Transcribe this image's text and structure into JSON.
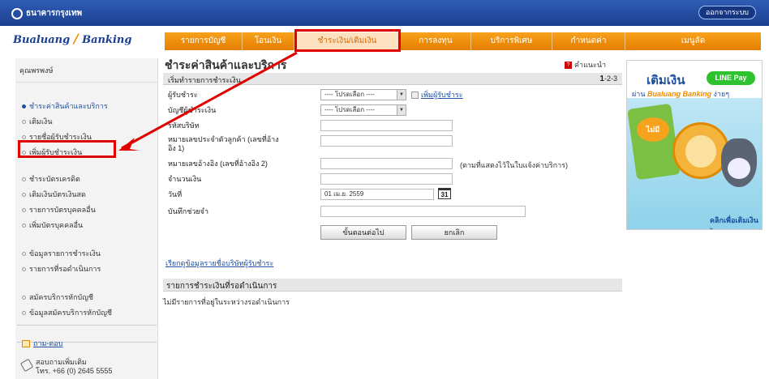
{
  "topbar": {
    "bank_name": "ธนาคารกรุงเทพ",
    "logout_label": "ออกจากระบบ"
  },
  "brand": {
    "left": "Bualuang",
    "right": "Banking"
  },
  "nav": {
    "items": [
      {
        "label": "รายการบัญชี",
        "active": false
      },
      {
        "label": "โอนเงิน",
        "active": false
      },
      {
        "label": "ชำระเงิน/เติมเงิน",
        "active": true
      },
      {
        "label": "การลงทุน",
        "active": false
      },
      {
        "label": "บริการพิเศษ",
        "active": false
      },
      {
        "label": "กำหนดค่า",
        "active": false
      },
      {
        "label": "เมนูลัด",
        "active": false
      }
    ]
  },
  "sidebar": {
    "user": "คุณพรพงษ์",
    "items": [
      {
        "label": "ชำระค่าสินค้าและบริการ",
        "active": true
      },
      {
        "label": "เติมเงิน",
        "active": false
      },
      {
        "label": "รายชื่อผู้รับชำระเงิน",
        "active": false
      },
      {
        "label": "เพิ่มผู้รับชำระเงิน",
        "active": false
      },
      {
        "label": "ชำระบัตรเครดิต",
        "active": false
      },
      {
        "label": "เติมเงินบัตรเงินสด",
        "active": false
      },
      {
        "label": "รายการบัตรบุคคลอื่น",
        "active": false
      },
      {
        "label": "เพิ่มบัตรบุคคลอื่น",
        "active": false
      },
      {
        "label": "ข้อมูลรายการชำระเงิน",
        "active": false
      },
      {
        "label": "รายการที่รอดำเนินการ",
        "active": false
      },
      {
        "label": "สมัครบริการหักบัญชี",
        "active": false
      },
      {
        "label": "ข้อมูลสมัครบริการหักบัญชี",
        "active": false
      }
    ],
    "faq": "ถาม-ตอบ",
    "contact_line1": "สอบถามเพิ่มเติม",
    "contact_line2": "โทร. +66 (0) 2645 5555"
  },
  "main": {
    "title": "ชำระค่าสินค้าและบริการ",
    "help": "คำแนะนำ",
    "step_title": "เริ่มทำรายการชำระเงิน",
    "step_current": "1",
    "step_rest": "-2-3",
    "fields": {
      "payee_label": "ผู้รับชำระ",
      "payee_value": "---- โปรดเลือก ----",
      "add_payee": "เพิ่มผู้รับชำระ",
      "account_label": "บัญชีผู้ชำระเงิน",
      "account_value": "---- โปรดเลือก ----",
      "company_code_label": "รหัสบริษัท",
      "ref1_label_line1": "หมายเลขประจำตัวลูกค้า (เลขที่อ้าง",
      "ref1_label_line2": "อิง 1)",
      "ref2_label": "หมายเลขอ้างอิง (เลขที่อ้างอิง 2)",
      "ref2_note": "(ตามที่แสดงไว้ในใบแจ้งค่าบริการ)",
      "amount_label": "จำนวนเงิน",
      "date_label": "วันที่",
      "date_value": "01 เม.ย. 2559",
      "calendar_icon_text": "31",
      "memo_label": "บันทึกช่วยจำ"
    },
    "next_button": "ขั้นตอนต่อไป",
    "cancel_button": "ยกเลิก",
    "view_list": "เรียกดูข้อมูลรายชื่อบริษัทผู้รับชำระ",
    "pending_title": "รายการชำระเงินที่รอดำเนินการ",
    "pending_empty": "ไม่มีรายการที่อยู่ในระหว่างรอดำเนินการ"
  },
  "ad": {
    "headline": "เติมเงิน",
    "badge": "LINE Pay",
    "sub_prefix": "ผ่าน",
    "sub_brand": "Bualuang Banking",
    "sub_suffix": "ง่ายๆ",
    "bubble": "ไม่มี",
    "cta": "คลิกเพื่อเติมเงิน >"
  },
  "colors": {
    "nav_orange": "#f08a00",
    "brand_blue": "#1b3f8f",
    "highlight_red": "#e10000"
  }
}
